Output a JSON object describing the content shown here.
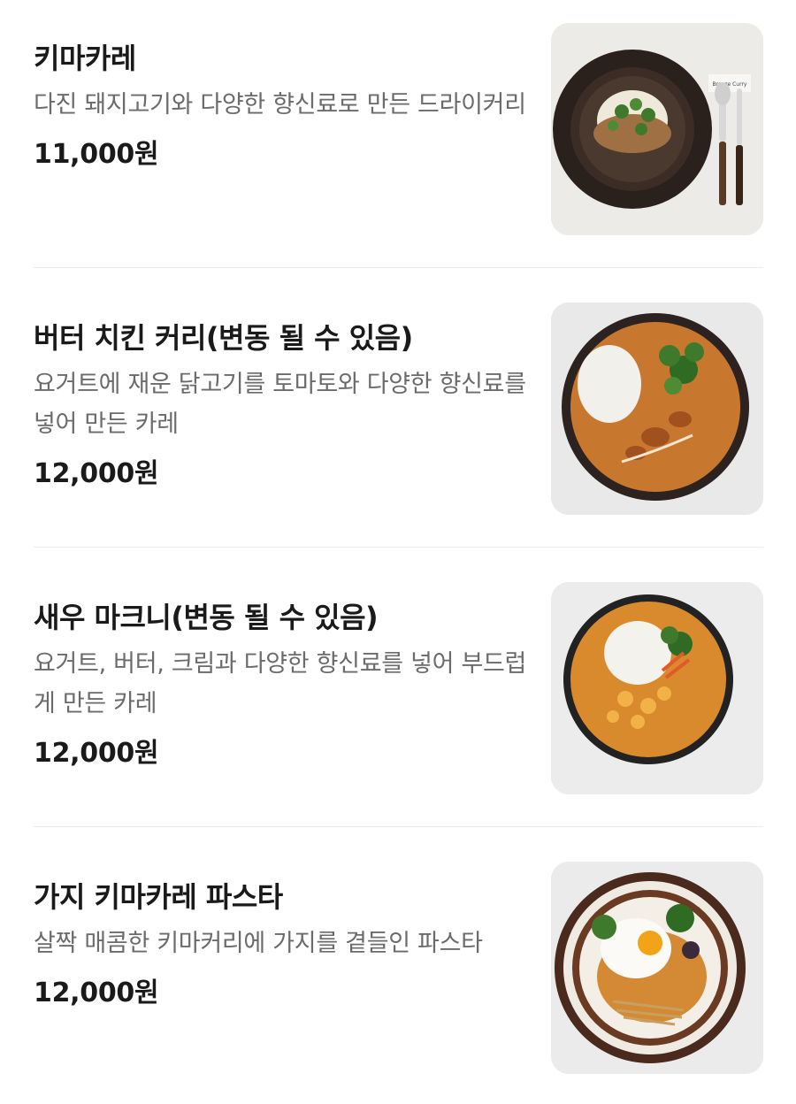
{
  "menu": {
    "items": [
      {
        "name": "키마카레",
        "description": "다진 돼지고기와 다양한 향신료로 만든 드라이커리",
        "price": "11,000원",
        "photo_icon": "keema-curry-photo"
      },
      {
        "name": "버터 치킨 커리(변동 될 수 있음)",
        "description": "요거트에 재운 닭고기를 토마토와 다양한 향신료를 넣어 만든 카레",
        "price": "12,000원",
        "photo_icon": "butter-chicken-curry-photo"
      },
      {
        "name": "새우 마크니(변동 될 수 있음)",
        "description": "요거트, 버터, 크림과 다양한 향신료를 넣어 부드럽게 만든 카레",
        "price": "12,000원",
        "photo_icon": "shrimp-makhani-photo"
      },
      {
        "name": "가지 키마카레 파스타",
        "description": "살짝 매콤한 키마커리에 가지를 곁들인 파스타",
        "price": "12,000원",
        "photo_icon": "eggplant-keema-pasta-photo"
      }
    ],
    "placemat_text": "Breeze Curry"
  },
  "colors": {
    "curry": "#c8782e",
    "plate_dark": "#3a2a22",
    "herb": "#3f7a2c",
    "price_text": "#1a1a1a",
    "desc_text": "#6b6b6b"
  }
}
